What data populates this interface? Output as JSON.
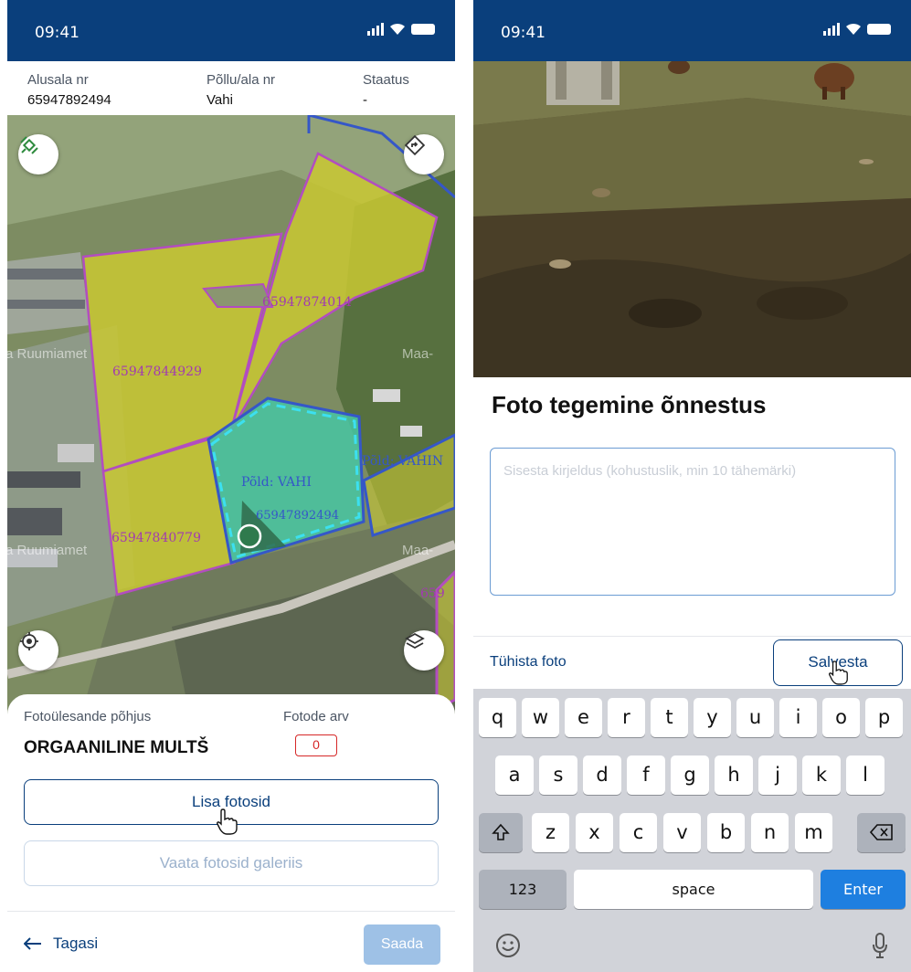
{
  "left": {
    "status_time": "09:41",
    "header": {
      "alusala_label": "Alusala nr",
      "alusala_value": "65947892494",
      "pollu_label": "Põllu/ala nr",
      "pollu_value": "Vahi",
      "staatus_label": "Staatus",
      "staatus_value": "-"
    },
    "map": {
      "parcel_labels": [
        "65947874014",
        "65947844929",
        "65947840779",
        "65947892494",
        "Põld: VAHI",
        "Põld: VAHIN",
        "659"
      ],
      "watermarks": [
        "a Ruumiamet",
        "Maa-",
        "a Ruumiamet",
        "Maa-"
      ],
      "buttons": [
        "satellite-icon",
        "navigation-icon",
        "locate-icon",
        "layers-icon"
      ]
    },
    "panel": {
      "reason_label": "Fotoülesande põhjus",
      "reason_value": "ORGAANILINE MULTŠ",
      "count_label": "Fotode arv",
      "count_value": "0",
      "add_photos_label": "Lisa fotosid",
      "gallery_label": "Vaata fotosid galeriis",
      "back_label": "Tagasi",
      "send_label": "Saada"
    }
  },
  "right": {
    "status_time": "09:41",
    "title": "Foto tegemine õnnestus",
    "description_placeholder": "Sisesta kirjeldus (kohustuslik, min 10 tähemärki)",
    "cancel_label": "Tühista foto",
    "save_label": "Salvesta",
    "keyboard": {
      "row1": [
        "q",
        "w",
        "e",
        "r",
        "t",
        "y",
        "u",
        "i",
        "o",
        "p"
      ],
      "row2": [
        "a",
        "s",
        "d",
        "f",
        "g",
        "h",
        "j",
        "k",
        "l"
      ],
      "row3": [
        "z",
        "x",
        "c",
        "v",
        "b",
        "n",
        "m"
      ],
      "numbers_label": "123",
      "space_label": "space",
      "enter_label": "Enter"
    }
  },
  "colors": {
    "brand": "#0a3f7c",
    "parcel_yellow": "#c9c833",
    "parcel_selected": "#47c5a3",
    "parcel_border": "#b24dc0",
    "field_border": "#3557c8",
    "badge_red": "#d62828",
    "enter_blue": "#1e7fe0"
  }
}
